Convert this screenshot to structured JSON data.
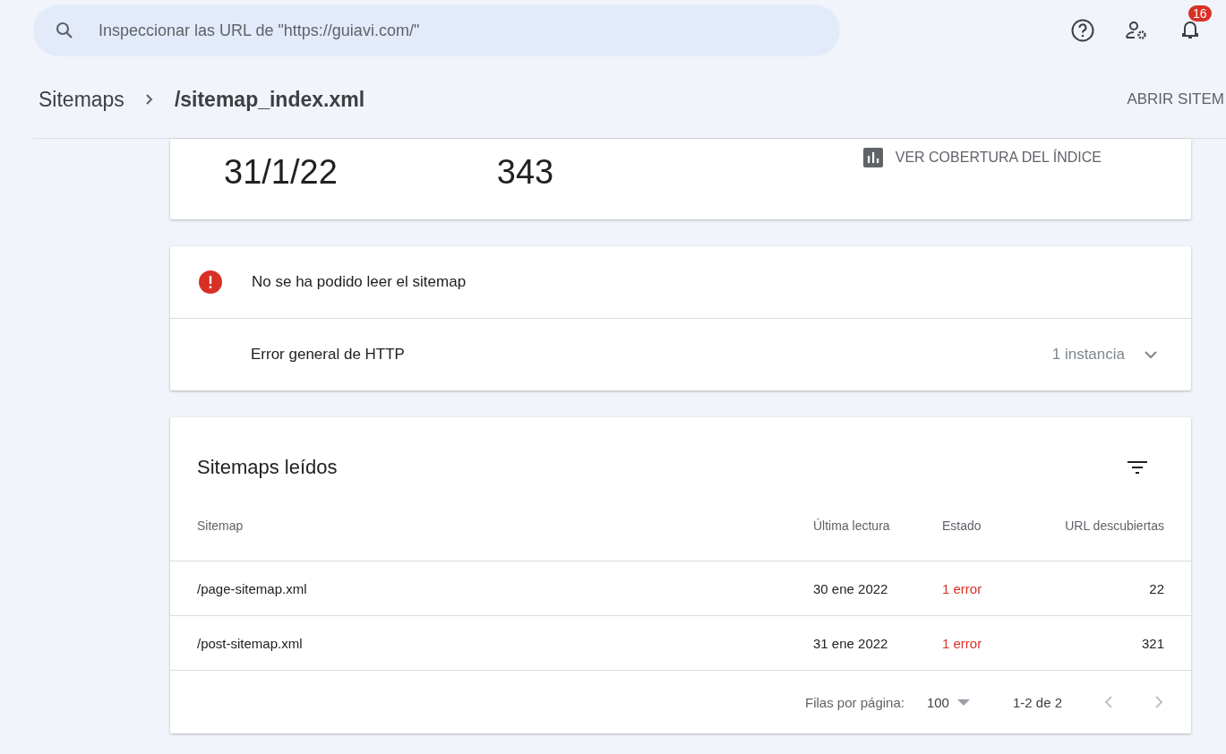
{
  "search": {
    "placeholder": "Inspeccionar las URL de \"https://guiavi.com/\""
  },
  "notifications": {
    "count": "16"
  },
  "breadcrumb": {
    "parent": "Sitemaps",
    "current": "/sitemap_index.xml",
    "action": "ABRIR SITEM"
  },
  "summary": {
    "values": [
      "31/1/22",
      "343"
    ],
    "link": "VER COBERTURA DEL ÍNDICE"
  },
  "errors": {
    "title": "No se ha podido leer el sitemap",
    "items": [
      {
        "label": "Error general de HTTP",
        "count": "1 instancia",
        "expanded": false
      }
    ]
  },
  "table": {
    "title": "Sitemaps leídos",
    "columns": [
      "Sitemap",
      "Última lectura",
      "Estado",
      "URL descubiertas"
    ],
    "rows": [
      {
        "cells": [
          "/page-sitemap.xml",
          "30 ene 2022",
          "1 error",
          "22"
        ]
      },
      {
        "cells": [
          "/post-sitemap.xml",
          "31 ene 2022",
          "1 error",
          "321"
        ]
      }
    ]
  },
  "pagination": {
    "rows_label": "Filas por página:",
    "rows_value": "100",
    "range": "1-2 de 2"
  }
}
